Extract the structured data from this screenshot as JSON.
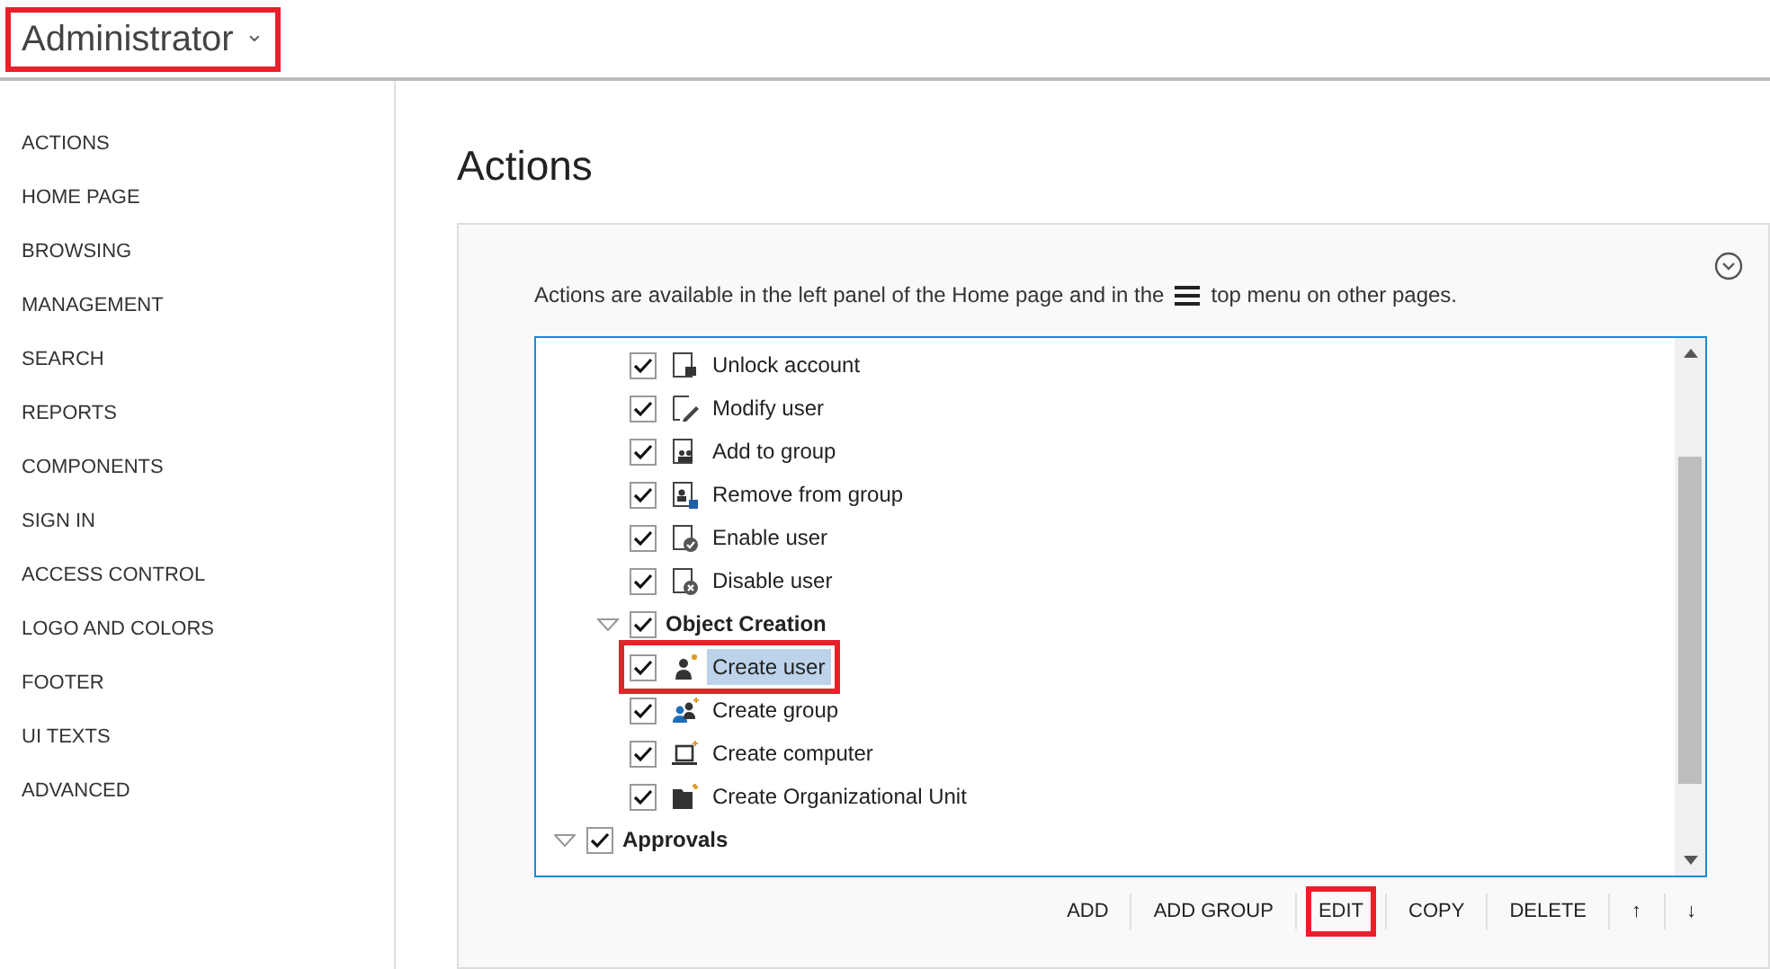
{
  "header": {
    "title": "Administrator",
    "caret": "⌄",
    "highlighted": true
  },
  "sidebar": {
    "items": [
      {
        "label": "ACTIONS"
      },
      {
        "label": "HOME PAGE"
      },
      {
        "label": "BROWSING"
      },
      {
        "label": "MANAGEMENT"
      },
      {
        "label": "SEARCH"
      },
      {
        "label": "REPORTS"
      },
      {
        "label": "COMPONENTS"
      },
      {
        "label": "SIGN IN"
      },
      {
        "label": "ACCESS CONTROL"
      },
      {
        "label": "LOGO AND COLORS"
      },
      {
        "label": "FOOTER"
      },
      {
        "label": "UI TEXTS"
      },
      {
        "label": "ADVANCED"
      }
    ]
  },
  "page": {
    "title": "Actions"
  },
  "card": {
    "description_before": "Actions are available in the left panel of the Home page and in the",
    "description_after": "top menu on other pages.",
    "tree": [
      {
        "children": [
          {
            "children": [
              {
                "label": "Unlock account",
                "checked": true,
                "selected": false,
                "highlighted": false
              },
              {
                "label": "Modify user",
                "checked": true,
                "selected": false,
                "highlighted": false
              },
              {
                "label": "Add to group",
                "checked": true,
                "selected": false,
                "highlighted": false
              },
              {
                "label": "Remove from group",
                "checked": true,
                "selected": false,
                "highlighted": false
              },
              {
                "label": "Enable user",
                "checked": true,
                "selected": false,
                "highlighted": false
              },
              {
                "label": "Disable user",
                "checked": true,
                "selected": false,
                "highlighted": false
              }
            ]
          },
          {
            "label": "Object Creation",
            "checked": true,
            "expanded": true,
            "selected": false,
            "highlighted": false,
            "children": [
              {
                "label": "Create user",
                "checked": true,
                "selected": true,
                "highlighted": true
              },
              {
                "label": "Create group",
                "checked": true,
                "selected": false,
                "highlighted": false
              },
              {
                "label": "Create computer",
                "checked": true,
                "selected": false,
                "highlighted": false
              },
              {
                "label": "Create Organizational Unit",
                "checked": true,
                "selected": false,
                "highlighted": false
              }
            ]
          }
        ]
      },
      {
        "label": "Approvals",
        "checked": true,
        "expanded": true,
        "selected": false,
        "highlighted": false
      }
    ],
    "buttons": [
      {
        "label": "ADD",
        "highlighted": false
      },
      {
        "label": "ADD GROUP",
        "highlighted": false
      },
      {
        "label": "EDIT",
        "highlighted": true
      },
      {
        "label": "COPY",
        "highlighted": false
      },
      {
        "label": "DELETE",
        "highlighted": false
      },
      {
        "label": "↑",
        "highlighted": false
      },
      {
        "label": "↓",
        "highlighted": false
      }
    ]
  }
}
